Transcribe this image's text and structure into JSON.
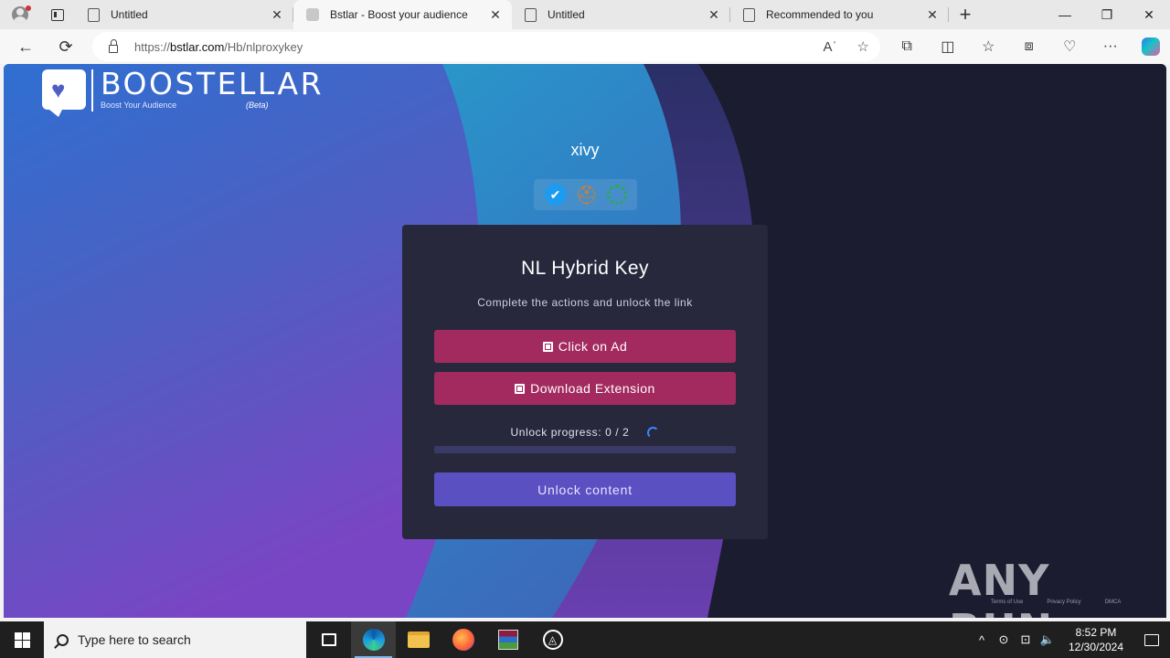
{
  "browser": {
    "tabs": [
      {
        "title": "Untitled",
        "active": false,
        "icon": "page-icon"
      },
      {
        "title": "Bstlar - Boost your audience",
        "active": true,
        "icon": "boostellar-favicon"
      },
      {
        "title": "Untitled",
        "active": false,
        "icon": "page-icon"
      },
      {
        "title": "Recommended to you",
        "active": false,
        "icon": "page-icon"
      }
    ],
    "tab_close": "✕",
    "new_tab": "+",
    "window": {
      "minimize": "—",
      "restore": "❐",
      "close": "✕"
    },
    "nav": {
      "back": "←",
      "refresh": "⟳"
    },
    "url_prefix": "https://",
    "url_host": "bstlar.com",
    "url_path": "/Hb/nlproxykey",
    "url_icons": {
      "read_aloud": "Aʾ",
      "favorite": "☆"
    },
    "toolbar": {
      "extensions": "⧉",
      "split": "◫",
      "favorites": "☆",
      "collections": "⧈",
      "performance": "♡",
      "more": "···"
    }
  },
  "page": {
    "logo": {
      "name": "BOOSTELLAR",
      "tagline": "Boost Your Audience",
      "beta": "(Beta)"
    },
    "username": "xivy",
    "card": {
      "title": "NL Hybrid Key",
      "subtitle": "Complete the actions and unlock the link",
      "action_1": "Click on Ad",
      "action_2": "Download Extension",
      "progress_label": "Unlock progress: 0 / 2",
      "progress_fraction": 0,
      "unlock_button": "Unlock content"
    },
    "watermark": "ANY RUN",
    "footer_links": [
      "Terms of Use",
      "Privacy Policy",
      "DMCA"
    ]
  },
  "taskbar": {
    "search_placeholder": "Type here to search",
    "time": "8:52 PM",
    "date": "12/30/2024",
    "tray": {
      "chevron": "^",
      "network": "⊡",
      "volume": "🔈"
    }
  },
  "colors": {
    "accent_button": "#a32a5f",
    "unlock_button": "#5b50c2",
    "card_bg": "#27283c"
  }
}
